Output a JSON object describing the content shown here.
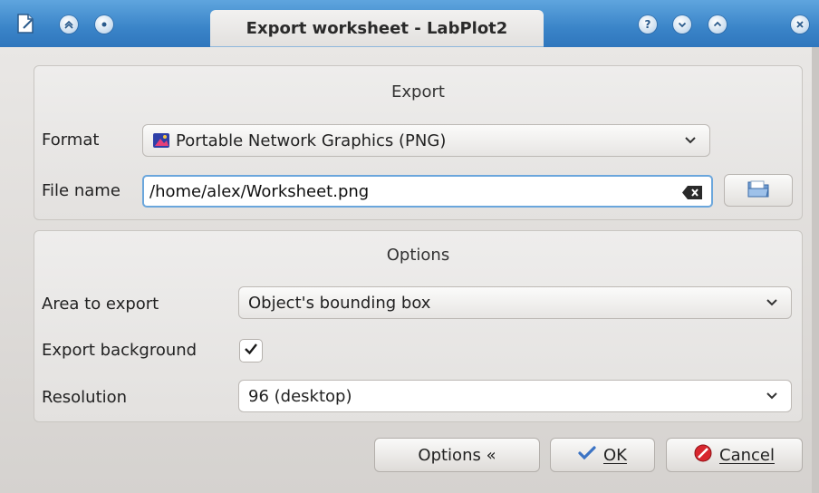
{
  "window": {
    "title": "Export worksheet - LabPlot2"
  },
  "titlebar_icons": {
    "app": "document-icon",
    "left": [
      "keep-above-icon",
      "on-all-desktops-icon"
    ],
    "right": [
      "help-icon",
      "minimize-icon",
      "maximize-icon",
      "close-icon"
    ]
  },
  "export_group": {
    "title": "Export",
    "format_label": "Format",
    "format_value": "Portable Network Graphics (PNG)",
    "filename_label": "File name",
    "filename_value": "/home/alex/Worksheet.png"
  },
  "options_group": {
    "title": "Options",
    "area_label": "Area to export",
    "area_value": "Object's bounding box",
    "background_label": "Export background",
    "background_checked": true,
    "resolution_label": "Resolution",
    "resolution_value": "96 (desktop)"
  },
  "buttons": {
    "options_label": "Options «",
    "ok_label": "OK",
    "cancel_label": "Cancel"
  },
  "colors": {
    "titlebar": "#3a84c8",
    "focus": "#6aa6dc",
    "ok_check": "#3b73c4",
    "cancel_red": "#d8262e"
  }
}
